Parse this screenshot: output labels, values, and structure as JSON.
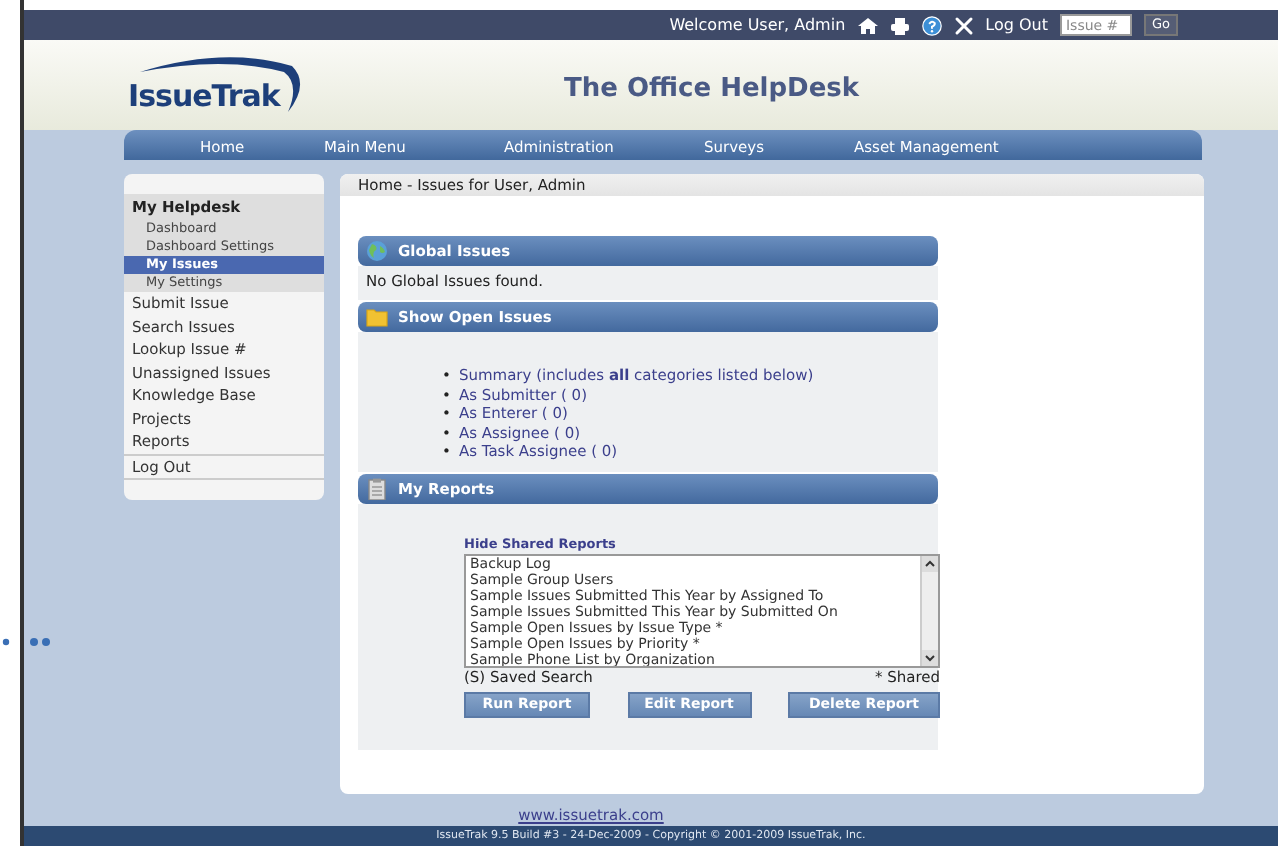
{
  "topbar": {
    "welcome": "Welcome User, Admin",
    "logout": "Log Out",
    "issue_field": {
      "placeholder": "Issue #"
    },
    "go_button": "Go"
  },
  "header": {
    "logo": "IssueTrak",
    "title": "The Office HelpDesk"
  },
  "nav": [
    "Home",
    "Main Menu",
    "Administration",
    "Surveys",
    "Asset Management"
  ],
  "sidebar": {
    "heading": "My Helpdesk",
    "items": [
      {
        "label": "Dashboard",
        "kind": "sub",
        "selected": false
      },
      {
        "label": "Dashboard Settings",
        "kind": "sub",
        "selected": false
      },
      {
        "label": "My Issues",
        "kind": "sub",
        "selected": true
      },
      {
        "label": "My Settings",
        "kind": "sub",
        "selected": false
      },
      {
        "label": "Submit Issue",
        "kind": "main",
        "selected": false
      },
      {
        "label": "Search Issues",
        "kind": "main",
        "selected": false
      },
      {
        "label": "Lookup Issue #",
        "kind": "main",
        "selected": false
      },
      {
        "label": "Unassigned Issues",
        "kind": "main",
        "selected": false
      },
      {
        "label": "Knowledge Base",
        "kind": "main",
        "selected": false
      },
      {
        "label": "Projects",
        "kind": "main",
        "selected": false
      },
      {
        "label": "Reports",
        "kind": "main",
        "selected": false
      },
      {
        "label": "Log Out",
        "kind": "separated",
        "selected": false
      }
    ]
  },
  "breadcrumb": "Home - Issues for User, Admin",
  "sections": [
    {
      "kind": "message",
      "title": "Global Issues",
      "message": "No Global Issues found."
    },
    {
      "kind": "links",
      "title": "Show Open Issues",
      "bullet": "•",
      "links": [
        "Summary (includes **all** categories listed below)",
        "As Submitter (   0)",
        "As Enterer (   0)",
        "As Assignee (   0)",
        "As Task Assignee (   0)"
      ]
    },
    {
      "kind": "reports",
      "title": "My Reports",
      "toggle": "Hide Shared Reports",
      "reports": [
        "Backup Log",
        "Sample Group Users",
        "Sample Issues Submitted This Year by Assigned To",
        "Sample Issues Submitted This Year by Submitted On",
        "Sample Open Issues by Issue Type *",
        "Sample Open Issues by Priority *",
        "Sample Phone List by Organization"
      ],
      "legend_left": "(S) Saved Search",
      "legend_right": "* Shared",
      "buttons": [
        "Run Report",
        "Edit Report",
        "Delete Report"
      ]
    }
  ],
  "footer": {
    "link": "www.issuetrak.com",
    "copyright": "IssueTrak 9.5 Build #3 - 24-Dec-2009 - Copyright © 2001-2009 IssueTrak, Inc."
  }
}
